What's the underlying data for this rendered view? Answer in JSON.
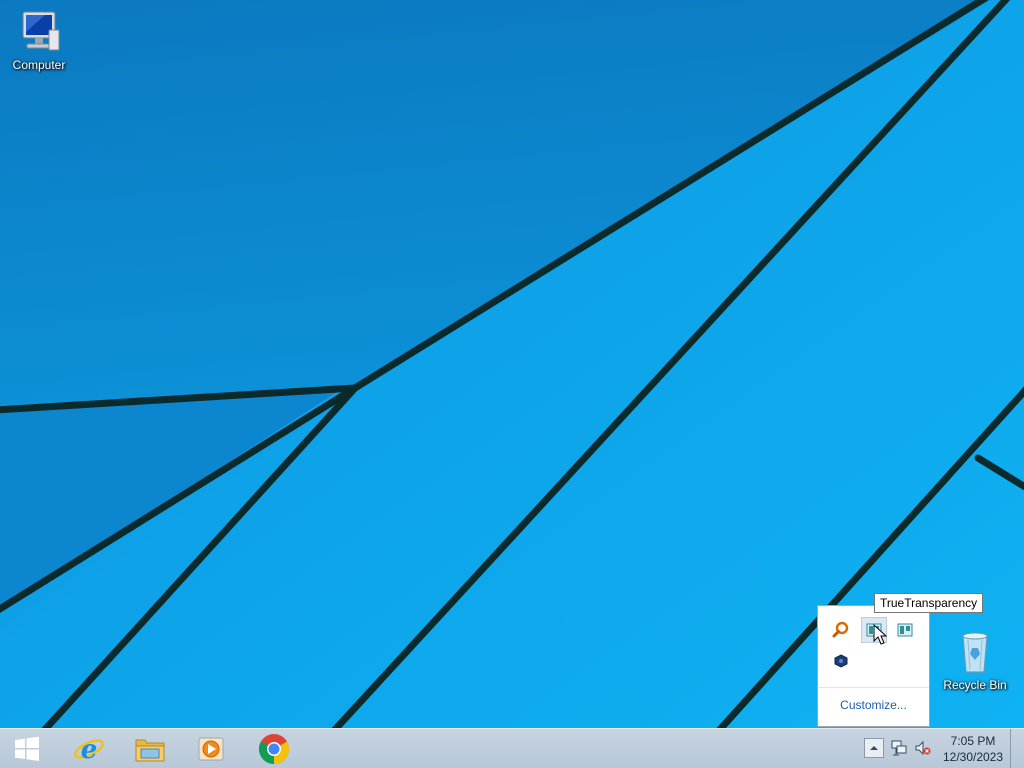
{
  "desktop": {
    "icons": [
      {
        "label": "Computer",
        "icon": "computer-icon"
      },
      {
        "label": "Recycle Bin",
        "icon": "recycle-bin-icon"
      }
    ]
  },
  "tray_popup": {
    "icons": [
      "magnifier-tray-icon",
      "truetransparency-tray-icon",
      "truetransparency-tray-icon-2",
      "settings-cube-tray-icon"
    ],
    "tooltip": "TrueTransparency",
    "customize_label": "Customize..."
  },
  "taskbar": {
    "start": "windows-logo-icon",
    "pinned": [
      "internet-explorer-icon",
      "file-explorer-icon",
      "windows-media-player-icon",
      "chrome-icon"
    ],
    "clock_time": "7:05 PM",
    "clock_date": "12/30/2023"
  },
  "colors": {
    "wallpaper": "#0a9ee6",
    "taskbar": "#c0cfdd",
    "link": "#1f5ea8"
  }
}
